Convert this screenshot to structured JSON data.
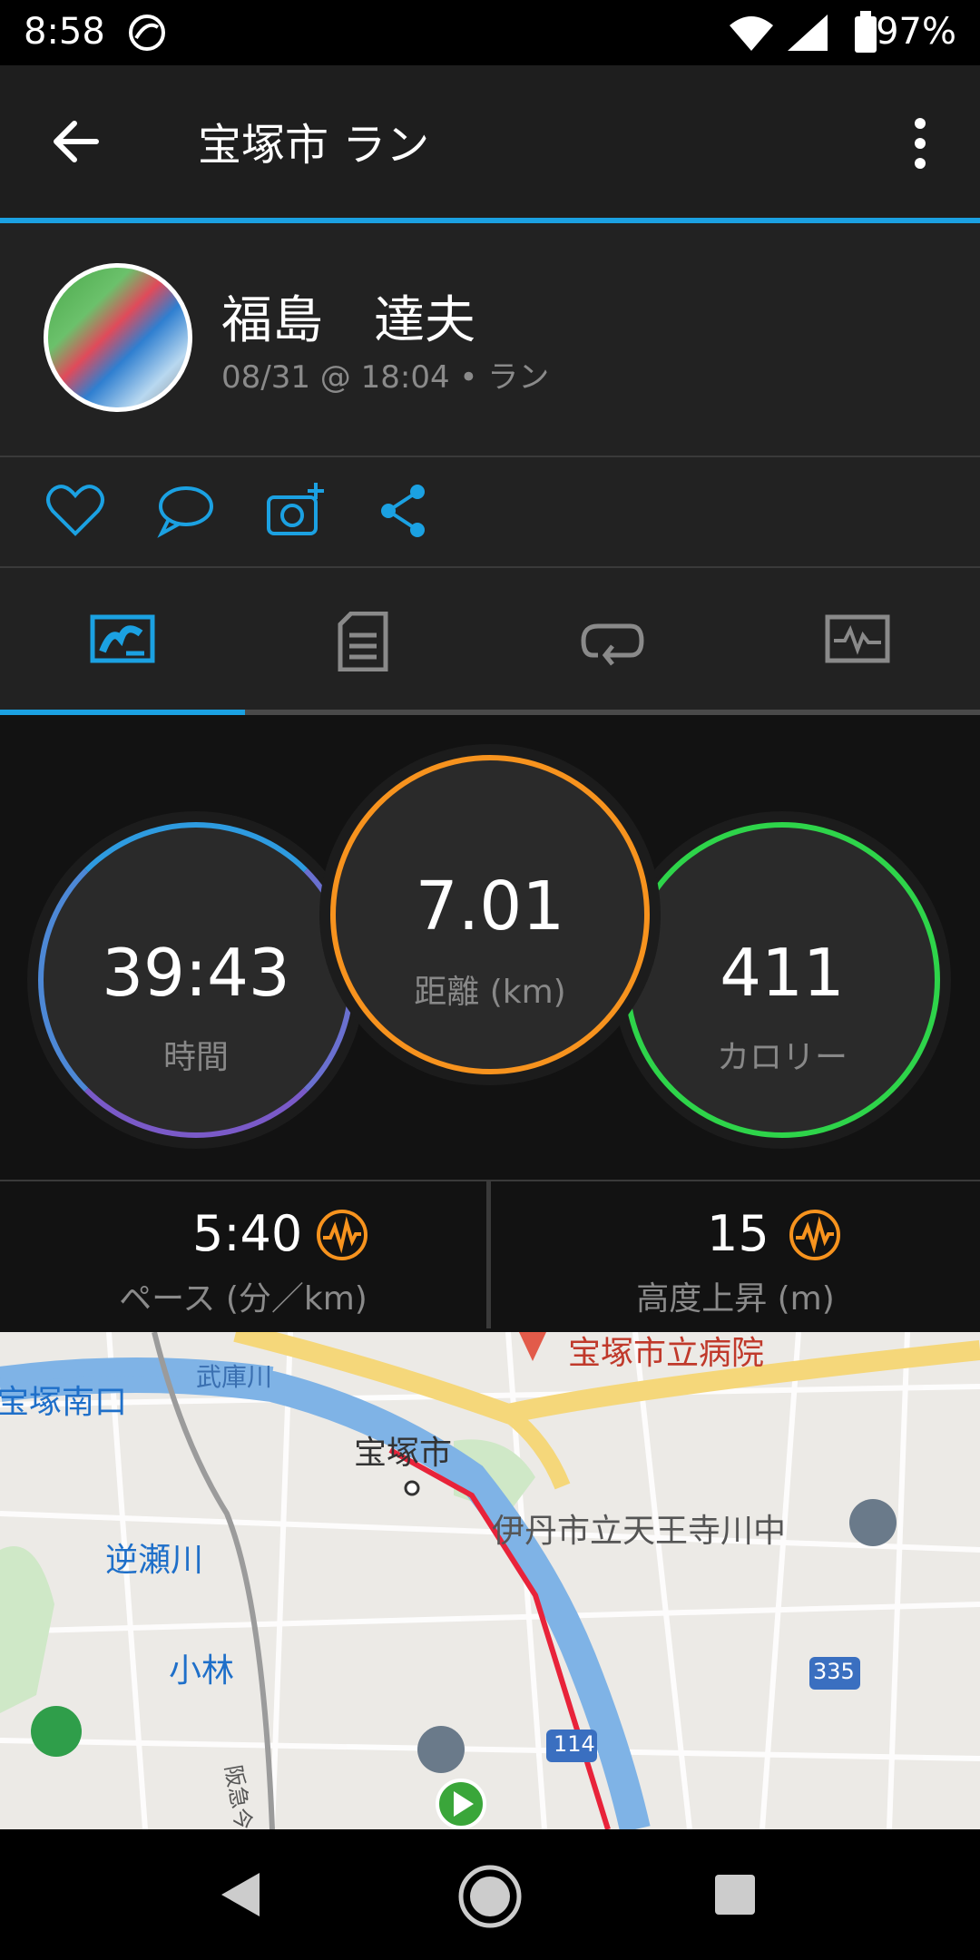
{
  "status_bar": {
    "time": "8:58",
    "battery": "97%"
  },
  "app_bar": {
    "title": "宝塚市 ラン"
  },
  "profile": {
    "name": "福島　達夫",
    "meta": "08/31 @ 18:04 • ラン"
  },
  "tabs": [
    {
      "icon": "overview-icon",
      "active": true
    },
    {
      "icon": "details-icon",
      "active": false
    },
    {
      "icon": "laps-icon",
      "active": false
    },
    {
      "icon": "graph-icon",
      "active": false
    }
  ],
  "stats": {
    "time": {
      "value": "39:43",
      "label": "時間"
    },
    "distance": {
      "value": "7.01",
      "label": "距離 (km)"
    },
    "calories": {
      "value": "411",
      "label": "カロリー"
    }
  },
  "metrics": {
    "pace": {
      "value": "5:40",
      "label": "ペース (分／km)"
    },
    "elevation": {
      "value": "15",
      "label": "高度上昇 (m)"
    }
  },
  "map": {
    "labels": {
      "station1": "宝塚南口",
      "river": "武庫川",
      "city": "宝塚市",
      "station2": "逆瀬川",
      "school": "伊丹市立天王寺川中",
      "station3": "小林",
      "hospital": "宝塚市立病院",
      "rail": "阪急今津",
      "route1": "335",
      "route2": "114"
    }
  },
  "colors": {
    "accent": "#1ba1e2",
    "time_ring_top": "#2e9be0",
    "time_ring_bottom": "#7a5ac8",
    "distance_ring": "#f7931e",
    "calories_ring": "#2ed44a",
    "route": "#e8233a"
  }
}
